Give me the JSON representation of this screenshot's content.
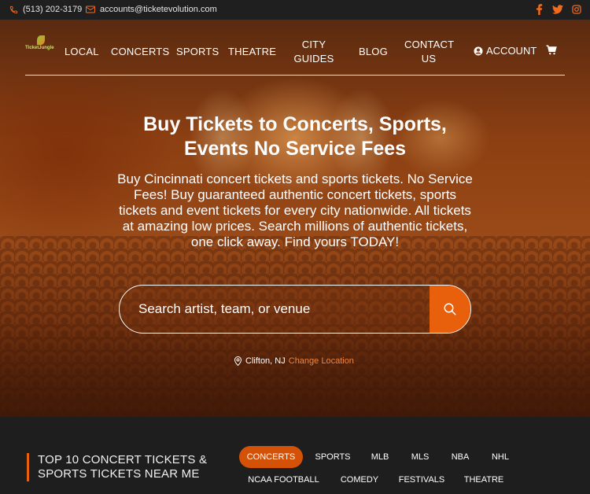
{
  "topbar": {
    "phone": "(513) 202-3179",
    "email": "accounts@ticketevolution.com",
    "social_icons": [
      "facebook-icon",
      "twitter-icon",
      "instagram-icon"
    ],
    "accent": "#f26b1d"
  },
  "nav": {
    "logo_text": "TicketJungle",
    "items": [
      "LOCAL",
      "CONCERTS",
      "SPORTS",
      "THEATRE",
      "CITY GUIDES",
      "BLOG",
      "CONTACT US"
    ],
    "city_line1": "CITY",
    "city_line2": "GUIDES",
    "contact_line1": "CONTACT",
    "contact_line2": "US",
    "account": "ACCOUNT"
  },
  "hero": {
    "title_line1": "Buy Tickets to Concerts, Sports,",
    "title_line2": "Events No Service Fees",
    "description": "Buy Cincinnati concert tickets and sports tickets. No Service Fees! Buy guaranteed authentic concert tickets, sports tickets and event tickets for every city nationwide. All tickets at amazing low prices. Search millions of authentic tickets, one click away. Find yours TODAY!",
    "search_placeholder": "Search artist, team, or venue",
    "location": "Clifton, NJ",
    "change_location": "Change Location"
  },
  "section": {
    "title": "TOP 10 CONCERT TICKETS & SPORTS TICKETS NEAR ME",
    "tabs": [
      "CONCERTS",
      "SPORTS",
      "MLB",
      "MLS",
      "NBA",
      "NHL",
      "NCAA FOOTBALL",
      "COMEDY",
      "FESTIVALS",
      "THEATRE"
    ],
    "active_tab": "CONCERTS"
  },
  "colors": {
    "accent": "#e8600c",
    "dark_bg": "#1e1e1e"
  }
}
